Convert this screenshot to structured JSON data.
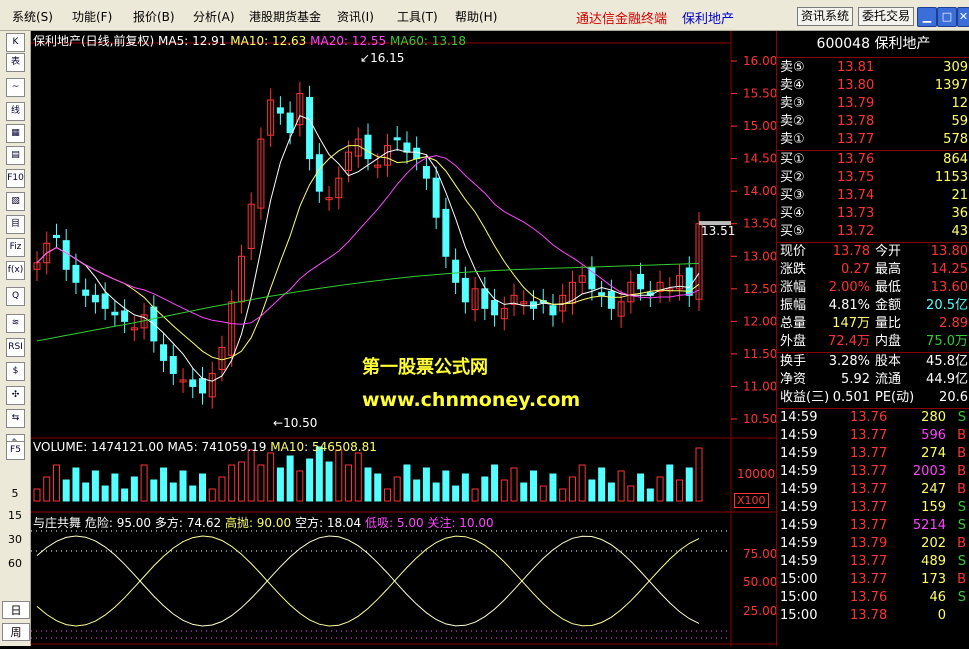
{
  "menu": {
    "items": [
      {
        "label": "系统",
        "key": "(S)"
      },
      {
        "label": "功能",
        "key": "(F)"
      },
      {
        "label": "报价",
        "key": "(B)"
      },
      {
        "label": "分析",
        "key": "(A)"
      },
      {
        "label": "港股期货基金",
        "key": ""
      },
      {
        "label": "资讯",
        "key": "(I)"
      },
      {
        "label": "工具",
        "key": "(T)"
      },
      {
        "label": "帮助",
        "key": "(H)"
      }
    ],
    "brand": "通达信金融终端",
    "stock_name": "保利地产",
    "btn_news": "资讯系统",
    "btn_trade": "委托交易"
  },
  "leftbar": {
    "tools": [
      "K",
      "表",
      "~",
      "线",
      "▦",
      "▤",
      "F10",
      "▧",
      "目",
      "Fiz",
      "f(x)",
      "Q",
      "≋",
      "RSI",
      "$",
      "✣",
      "⇆",
      "✎",
      "F5"
    ],
    "periods": [
      "15",
      "30",
      "60",
      "日",
      "周"
    ],
    "zoom": [
      "5"
    ]
  },
  "main_chart": {
    "title": "保利地产(日线,前复权)",
    "ma5": "MA5: 12.91",
    "ma10": "MA10: 12.63",
    "ma20": "MA20: 12.55",
    "ma60": "MA60: 13.18",
    "high_label": "16.15",
    "low_label": "10.50",
    "last_label": "13.51",
    "watermark_cn": "第一股票公式网",
    "watermark_url": "www.chnmoney.com",
    "colors": {
      "up": "#ff3333",
      "down": "#54ffff",
      "ma5": "#ffffff",
      "ma10": "#ffff66",
      "ma20": "#ff44ff",
      "ma60": "#33cc33"
    },
    "yticks": [
      "16.00",
      "15.50",
      "15.00",
      "14.50",
      "14.00",
      "13.50",
      "13.00",
      "12.50",
      "12.00",
      "11.50",
      "11.00",
      "10.50"
    ]
  },
  "volume": {
    "title": "VOLUME: 1474121.00",
    "ma5": "MA5: 741059.19",
    "ma10": "MA10: 546508.81",
    "ytick": "10000",
    "unit": "X100",
    "left_tick": "5"
  },
  "indicator": {
    "name": "与庄共舞",
    "danger": "危险: 95.00",
    "bull": "多方: 74.62",
    "high_sell": "高抛: 90.00",
    "bear": "空方: 18.04",
    "low_buy": "低吸: 5.00",
    "watch": "关注: 10.00",
    "yticks": [
      "75.00",
      "50.00",
      "25.00"
    ]
  },
  "quote": {
    "header": "600048 保利地产",
    "asks": [
      {
        "label": "卖⑤",
        "price": "13.81",
        "vol": "309"
      },
      {
        "label": "卖④",
        "price": "13.80",
        "vol": "1397"
      },
      {
        "label": "卖③",
        "price": "13.79",
        "vol": "12"
      },
      {
        "label": "卖②",
        "price": "13.78",
        "vol": "59"
      },
      {
        "label": "卖①",
        "price": "13.77",
        "vol": "578"
      }
    ],
    "bids": [
      {
        "label": "买①",
        "price": "13.76",
        "vol": "864"
      },
      {
        "label": "买②",
        "price": "13.75",
        "vol": "1153"
      },
      {
        "label": "买③",
        "price": "13.74",
        "vol": "21"
      },
      {
        "label": "买④",
        "price": "13.73",
        "vol": "36"
      },
      {
        "label": "买⑤",
        "price": "13.72",
        "vol": "43"
      }
    ],
    "stats": [
      {
        "l1": "现价",
        "v1": "13.78",
        "l2": "今开",
        "v2": "13.80",
        "c1": "#ff3333",
        "c2": "#ff3333"
      },
      {
        "l1": "涨跌",
        "v1": "0.27",
        "l2": "最高",
        "v2": "14.25",
        "c1": "#ff3333",
        "c2": "#ff3333"
      },
      {
        "l1": "涨幅",
        "v1": "2.00%",
        "l2": "最低",
        "v2": "13.60",
        "c1": "#ff3333",
        "c2": "#ff3333"
      },
      {
        "l1": "振幅",
        "v1": "4.81%",
        "l2": "金额",
        "v2": "20.5亿",
        "c1": "#ffffff",
        "c2": "#54ffff"
      },
      {
        "l1": "总量",
        "v1": "147万",
        "l2": "量比",
        "v2": "2.89",
        "c1": "#ffff66",
        "c2": "#ff3333"
      },
      {
        "l1": "外盘",
        "v1": "72.4万",
        "l2": "内盘",
        "v2": "75.0万",
        "c1": "#ff3333",
        "c2": "#33cc33"
      }
    ],
    "stats2": [
      {
        "l1": "换手",
        "v1": "3.28%",
        "l2": "股本",
        "v2": "45.8亿"
      },
      {
        "l1": "净资",
        "v1": "5.92",
        "l2": "流通",
        "v2": "44.9亿"
      },
      {
        "l1": "收益(三)",
        "v1": "0.501",
        "l2": "PE(动)",
        "v2": "20.6"
      }
    ],
    "ticks": [
      {
        "time": "14:59",
        "price": "13.76",
        "vol": "280",
        "side": "S",
        "pc": "#ff3333",
        "vc": "#ffff66",
        "sc": "#33cc33"
      },
      {
        "time": "14:59",
        "price": "13.77",
        "vol": "596",
        "side": "B",
        "pc": "#ff3333",
        "vc": "#ff44ff",
        "sc": "#ff3333"
      },
      {
        "time": "14:59",
        "price": "13.77",
        "vol": "274",
        "side": "B",
        "pc": "#ff3333",
        "vc": "#ffff66",
        "sc": "#ff3333"
      },
      {
        "time": "14:59",
        "price": "13.77",
        "vol": "2003",
        "side": "B",
        "pc": "#ff3333",
        "vc": "#ff44ff",
        "sc": "#ff3333"
      },
      {
        "time": "14:59",
        "price": "13.77",
        "vol": "247",
        "side": "B",
        "pc": "#ff3333",
        "vc": "#ffff66",
        "sc": "#ff3333"
      },
      {
        "time": "14:59",
        "price": "13.77",
        "vol": "159",
        "side": "S",
        "pc": "#ff3333",
        "vc": "#ffff66",
        "sc": "#33cc33"
      },
      {
        "time": "14:59",
        "price": "13.77",
        "vol": "5214",
        "side": "S",
        "pc": "#ff3333",
        "vc": "#ff44ff",
        "sc": "#33cc33"
      },
      {
        "time": "14:59",
        "price": "13.79",
        "vol": "202",
        "side": "B",
        "pc": "#ff3333",
        "vc": "#ffff66",
        "sc": "#ff3333"
      },
      {
        "time": "14:59",
        "price": "13.77",
        "vol": "489",
        "side": "S",
        "pc": "#ff3333",
        "vc": "#ffff66",
        "sc": "#33cc33"
      },
      {
        "time": "15:00",
        "price": "13.77",
        "vol": "173",
        "side": "B",
        "pc": "#ff3333",
        "vc": "#ffff66",
        "sc": "#ff3333"
      },
      {
        "time": "15:00",
        "price": "13.76",
        "vol": "46",
        "side": "S",
        "pc": "#ff3333",
        "vc": "#ffff66",
        "sc": "#33cc33"
      },
      {
        "time": "15:00",
        "price": "13.78",
        "vol": "0",
        "side": "",
        "pc": "#ff3333",
        "vc": "#ffff66",
        "sc": "#ffffff"
      }
    ]
  }
}
